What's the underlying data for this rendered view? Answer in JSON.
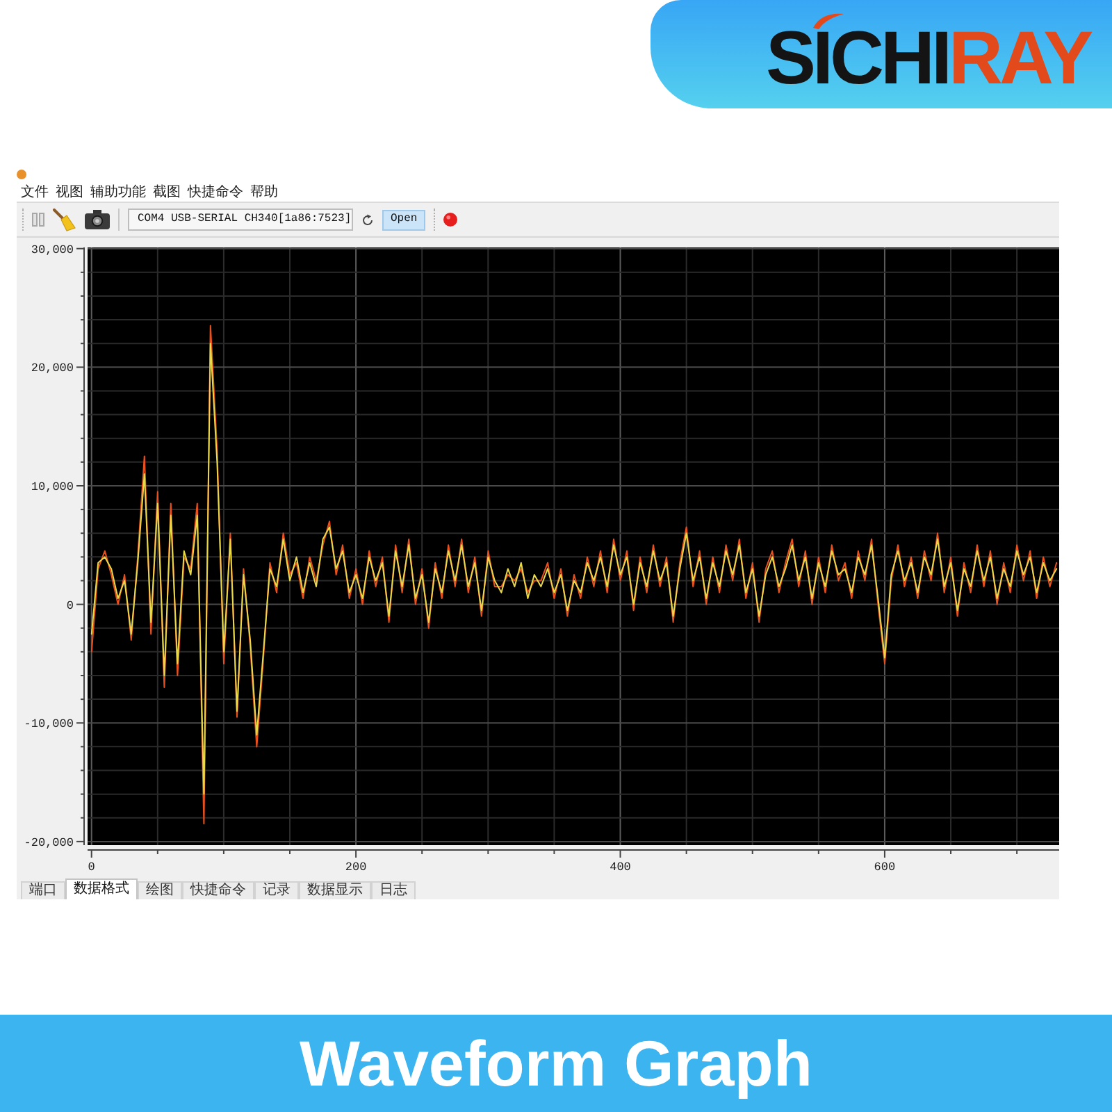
{
  "header": {
    "logo": [
      {
        "text": "SICHI",
        "color": "#141414"
      },
      {
        "text": "RAY",
        "color": "#e24a1c"
      }
    ]
  },
  "app": {
    "menu": [
      "文件",
      "视图",
      "辅助功能",
      "截图",
      "快捷命令",
      "帮助"
    ],
    "toolbar": {
      "port": "COM4 USB-SERIAL CH340[1a86:7523]",
      "open_button": "Open"
    },
    "chart": {
      "chart_data": {
        "type": "line",
        "grid": true,
        "x": [
          0,
          5,
          10,
          15,
          20,
          25,
          30,
          35,
          40,
          45,
          50,
          55,
          60,
          65,
          70,
          75,
          80,
          85,
          90,
          95,
          100,
          105,
          110,
          115,
          120,
          125,
          130,
          135,
          140,
          145,
          150,
          155,
          160,
          165,
          170,
          175,
          180,
          185,
          190,
          195,
          200,
          205,
          210,
          215,
          220,
          225,
          230,
          235,
          240,
          245,
          250,
          255,
          260,
          265,
          270,
          275,
          280,
          285,
          290,
          295,
          300,
          305,
          310,
          315,
          320,
          325,
          330,
          335,
          340,
          345,
          350,
          355,
          360,
          365,
          370,
          375,
          380,
          385,
          390,
          395,
          400,
          405,
          410,
          415,
          420,
          425,
          430,
          435,
          440,
          445,
          450,
          455,
          460,
          465,
          470,
          475,
          480,
          485,
          490,
          495,
          500,
          505,
          510,
          515,
          520,
          525,
          530,
          535,
          540,
          545,
          550,
          555,
          560,
          565,
          570,
          575,
          580,
          585,
          590,
          595,
          600,
          605,
          610,
          615,
          620,
          625,
          630,
          635,
          640,
          645,
          650,
          655,
          660,
          665,
          670,
          675,
          680,
          685,
          690,
          695,
          700,
          705,
          710,
          715,
          720,
          725,
          730
        ],
        "series": [
          {
            "color": "#e8501e",
            "values": [
              -4000,
              3000,
              4500,
              2500,
              0,
              2500,
              -3000,
              4000,
              12500,
              -2500,
              9500,
              -7000,
              8500,
              -6000,
              4000,
              3000,
              8500,
              -18500,
              23500,
              13000,
              -5000,
              6000,
              -9500,
              3000,
              -3500,
              -12000,
              -4500,
              3500,
              1000,
              6000,
              2500,
              3500,
              500,
              4000,
              2000,
              5000,
              7000,
              2500,
              5000,
              500,
              3000,
              0,
              4500,
              1500,
              4000,
              -1500,
              5000,
              1000,
              5500,
              0,
              3000,
              -2000,
              3500,
              500,
              5000,
              1500,
              5500,
              1000,
              4000,
              -1000,
              4500,
              1500,
              1500,
              2500,
              2000,
              3000,
              1000,
              2000,
              2000,
              3500,
              500,
              3000,
              -1000,
              2500,
              500,
              4000,
              1500,
              4500,
              1000,
              5500,
              2000,
              4500,
              -500,
              4000,
              1000,
              5000,
              1500,
              4000,
              -1500,
              3500,
              6500,
              1500,
              4500,
              0,
              4000,
              1000,
              5000,
              2000,
              5500,
              500,
              3500,
              -1500,
              3000,
              4500,
              1000,
              3500,
              5500,
              1500,
              4500,
              0,
              4000,
              1000,
              5000,
              2000,
              3500,
              500,
              4500,
              2000,
              5500,
              0,
              -5000,
              2000,
              5000,
              1500,
              4000,
              500,
              4500,
              2000,
              6000,
              1000,
              4000,
              -1000,
              3500,
              1000,
              5000,
              1500,
              4500,
              0,
              3500,
              1000,
              5000,
              2000,
              4500,
              500,
              4000,
              1500,
              3500
            ]
          },
          {
            "color": "#e8d84a",
            "values": [
              -2500,
              3500,
              4000,
              3000,
              500,
              2000,
              -2500,
              3500,
              11000,
              -1500,
              8500,
              -6000,
              7500,
              -5000,
              4500,
              2500,
              7500,
              -16000,
              22000,
              12000,
              -4000,
              5500,
              -9000,
              2500,
              -3000,
              -11000,
              -4000,
              3000,
              1500,
              5500,
              2000,
              4000,
              1000,
              3500,
              1500,
              5500,
              6500,
              3000,
              4500,
              1000,
              2500,
              500,
              4000,
              2000,
              3500,
              -1000,
              4500,
              1500,
              5000,
              500,
              2500,
              -1500,
              3000,
              1000,
              4500,
              2000,
              5000,
              1500,
              3500,
              -500,
              4000,
              2000,
              1000,
              3000,
              1500,
              3500,
              500,
              2500,
              1500,
              3000,
              1000,
              2500,
              -500,
              2000,
              1000,
              3500,
              2000,
              4000,
              1500,
              5000,
              2500,
              4000,
              0,
              3500,
              1500,
              4500,
              2000,
              3500,
              -1000,
              3000,
              6000,
              2000,
              4000,
              500,
              3500,
              1500,
              4500,
              2500,
              5000,
              1000,
              3000,
              -1000,
              2500,
              4000,
              1500,
              3000,
              5000,
              2000,
              4000,
              500,
              3500,
              1500,
              4500,
              2500,
              3000,
              1000,
              4000,
              2500,
              5000,
              500,
              -4500,
              2500,
              4500,
              2000,
              3500,
              1000,
              4000,
              2500,
              5500,
              1500,
              3500,
              -500,
              3000,
              1500,
              4500,
              2000,
              4000,
              500,
              3000,
              1500,
              4500,
              2500,
              4000,
              1000,
              3500,
              2000,
              3000
            ]
          }
        ],
        "xlim": [
          -3,
          732
        ],
        "ylim": [
          -20300,
          30100
        ],
        "xticks": [
          0,
          200,
          400,
          600
        ],
        "yticks": [
          {
            "value": 30000,
            "label": "30,000"
          },
          {
            "value": 20000,
            "label": "20,000"
          },
          {
            "value": 10000,
            "label": "10,000"
          },
          {
            "value": 0,
            "label": "0"
          },
          {
            "value": -10000,
            "label": "-10,000"
          },
          {
            "value": -20000,
            "label": "-20,000"
          }
        ]
      }
    },
    "tabs": [
      {
        "label": "端口",
        "selected": false
      },
      {
        "label": "数据格式",
        "selected": true
      },
      {
        "label": "绘图",
        "selected": false
      },
      {
        "label": "快捷命令",
        "selected": false
      },
      {
        "label": "记录",
        "selected": false
      },
      {
        "label": "数据显示",
        "selected": false
      },
      {
        "label": "日志",
        "selected": false
      }
    ]
  },
  "caption": "Waveform Graph"
}
